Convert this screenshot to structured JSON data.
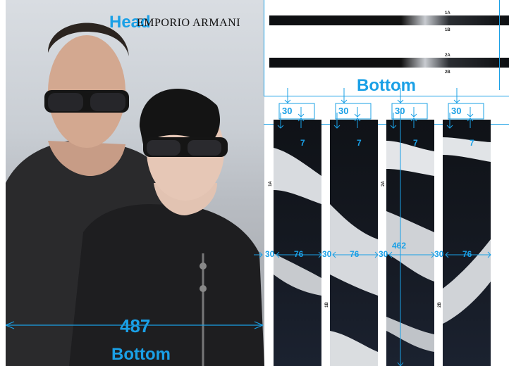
{
  "poster": {
    "brand": "EMPORIO ARMANI",
    "head_label": "Head",
    "bottom_label": "Bottom",
    "width_label": "487"
  },
  "banner": {
    "labels": [
      "1A",
      "1B",
      "2A",
      "2B"
    ],
    "bottom_label": "Bottom"
  },
  "strips": {
    "gap_labels": [
      "30",
      "30",
      "30",
      "30"
    ],
    "inner_labels": [
      "7",
      "7",
      "7",
      "7"
    ],
    "side_labels": [
      "30",
      "30",
      "30",
      "30"
    ],
    "width_labels": [
      "76",
      "76",
      "462",
      "76"
    ],
    "vertical_labels": [
      "1A",
      "1B",
      "2A",
      "2B"
    ]
  },
  "colors": {
    "accent": "#1aa0e6",
    "dark": "#0f1217"
  }
}
